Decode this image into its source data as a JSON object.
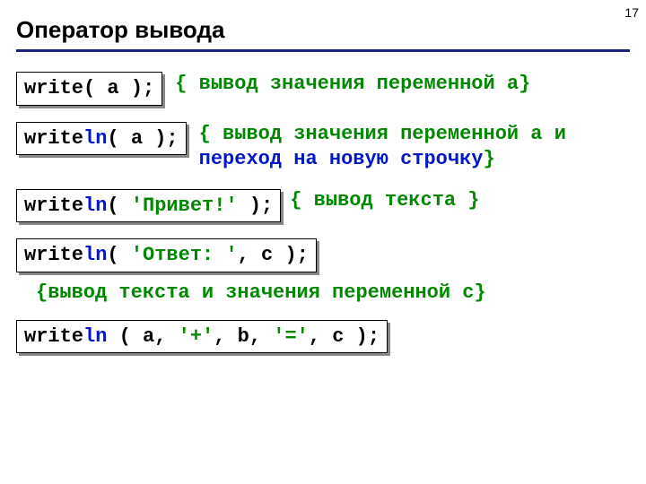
{
  "page_number": "17",
  "title": "Оператор вывода",
  "row1": {
    "code_head": "write",
    "code_tail": "( a );",
    "desc_open": "{ ",
    "desc_body": "вывод значения переменной a",
    "desc_close": "}"
  },
  "row2": {
    "code_head": "write",
    "code_blue": "ln",
    "code_tail": "( a );",
    "desc_open": "{ ",
    "desc_body1": "вывод значения переменной a и ",
    "desc_blue": "переход на новую строчку",
    "desc_close": "}"
  },
  "row3": {
    "code_head": "write",
    "code_blue": "ln",
    "code_paren_open": "( ",
    "code_literal": "'Привет!'",
    "code_paren_close": " );",
    "desc": "{ вывод текста }"
  },
  "row4": {
    "code_head": "write",
    "code_blue": "ln",
    "code_paren_open": "( ",
    "code_literal": "'Ответ: '",
    "code_tail": ", c );"
  },
  "row4_desc": "{вывод текста и значения переменной c}",
  "row5": {
    "code_head": "write",
    "code_blue": "ln",
    "code_mid1": " ( a, ",
    "code_lit1": "'+'",
    "code_mid2": ", b, ",
    "code_lit2": "'='",
    "code_tail": ", c );"
  }
}
